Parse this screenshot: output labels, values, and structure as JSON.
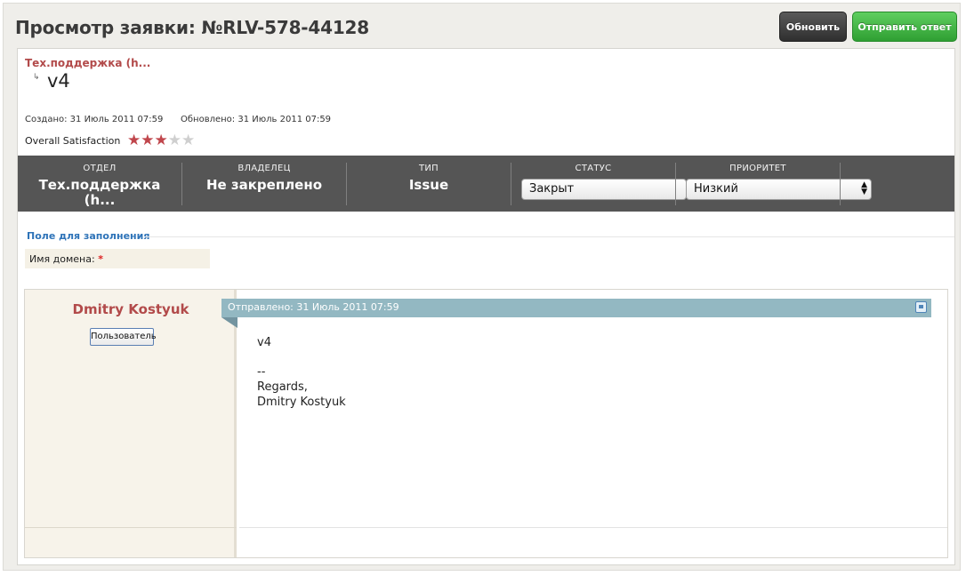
{
  "header": {
    "title": "Просмотр заявки: №RLV-578-44128",
    "refresh_label": "Обновить",
    "reply_label": "Отправить ответ"
  },
  "ticket": {
    "department_short": "Тех.поддержка (h...",
    "subject": "v4",
    "created": "Создано: 31 Июль 2011 07:59",
    "updated": "Обновлено: 31 Июль 2011 07:59",
    "satisfaction_label": "Overall Satisfaction",
    "satisfaction_rating": 3,
    "satisfaction_max": 5
  },
  "infobar": {
    "department": {
      "label": "ОТДЕЛ",
      "value": "Тех.поддержка (h..."
    },
    "owner": {
      "label": "ВЛАДЕЛЕЦ",
      "value": "Не закреплено"
    },
    "type": {
      "label": "ТИП",
      "value": "Issue"
    },
    "status": {
      "label": "СТАТУС",
      "value": "Закрыт"
    },
    "priority": {
      "label": "ПРИОРИТЕТ",
      "value": "Низкий"
    }
  },
  "custom_fields": {
    "title": "Поле для заполнения",
    "domain_label": "Имя домена:",
    "required_mark": "*"
  },
  "post": {
    "author": "Dmitry Kostyuk",
    "role": "Пользователь",
    "sent": "Отправлено: 31 Июль 2011 07:59",
    "lines": [
      "v4",
      "--",
      "Regards,",
      "Dmitry Kostyuk"
    ]
  },
  "icons": {
    "star": "star-icon",
    "quote": "quote-icon",
    "arrow": "subject-arrow-icon"
  },
  "colors": {
    "accent_red": "#b24a4a",
    "bar_gray": "#555555",
    "reply_green": "#3fb343",
    "post_header": "#93b8c2",
    "link_blue": "#2e73b8"
  }
}
